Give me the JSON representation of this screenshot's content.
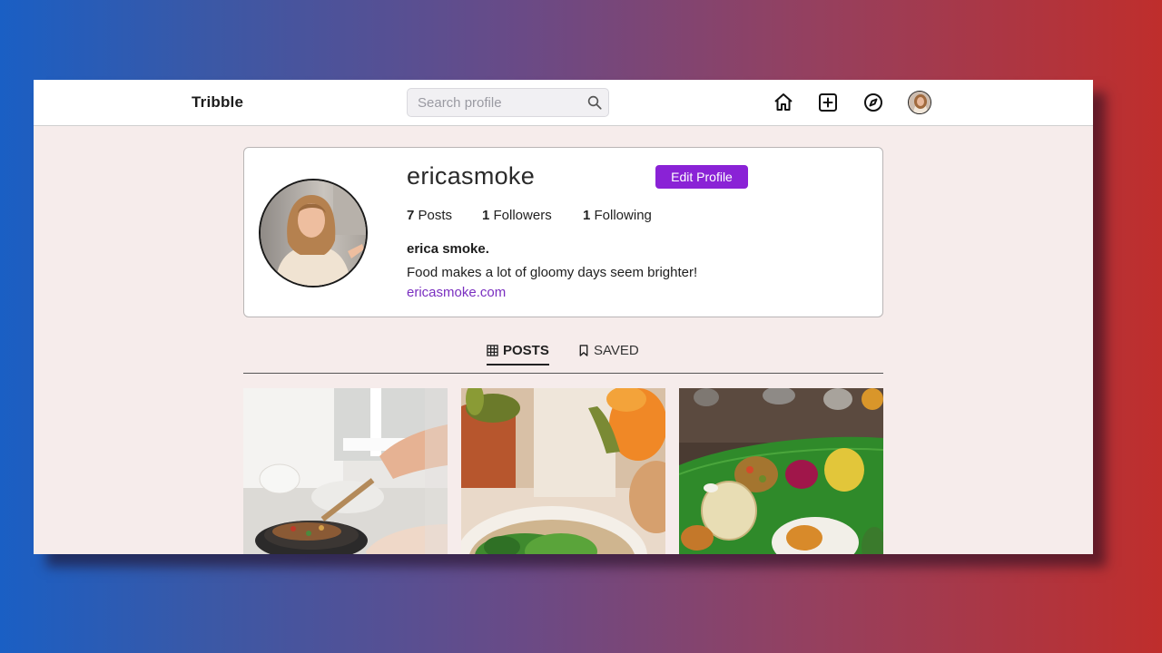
{
  "navbar": {
    "brand": "Tribble",
    "search_placeholder": "Search profile",
    "icons": [
      "home-icon",
      "add-post-icon",
      "explore-compass-icon",
      "profile-avatar"
    ]
  },
  "profile": {
    "username": "ericasmoke",
    "edit_label": "Edit Profile",
    "stats": {
      "posts_count": "7",
      "posts_label": "Posts",
      "followers_count": "1",
      "followers_label": "Followers",
      "following_count": "1",
      "following_label": "Following"
    },
    "full_name": "erica smoke.",
    "bio": "Food makes a lot of gloomy days seem brighter!",
    "website": "ericasmoke.com"
  },
  "tabs": [
    {
      "label": "POSTS",
      "icon": "grid-icon",
      "active": true
    },
    {
      "label": "SAVED",
      "icon": "bookmark-icon",
      "active": false
    }
  ],
  "posts": [
    {
      "subject": "cooking-in-pan"
    },
    {
      "subject": "salad-bowl"
    },
    {
      "subject": "banana-leaf-meal"
    }
  ],
  "colors": {
    "accent": "#8a22d6",
    "link": "#7a2fc0",
    "page_background": "#f6eceb"
  }
}
